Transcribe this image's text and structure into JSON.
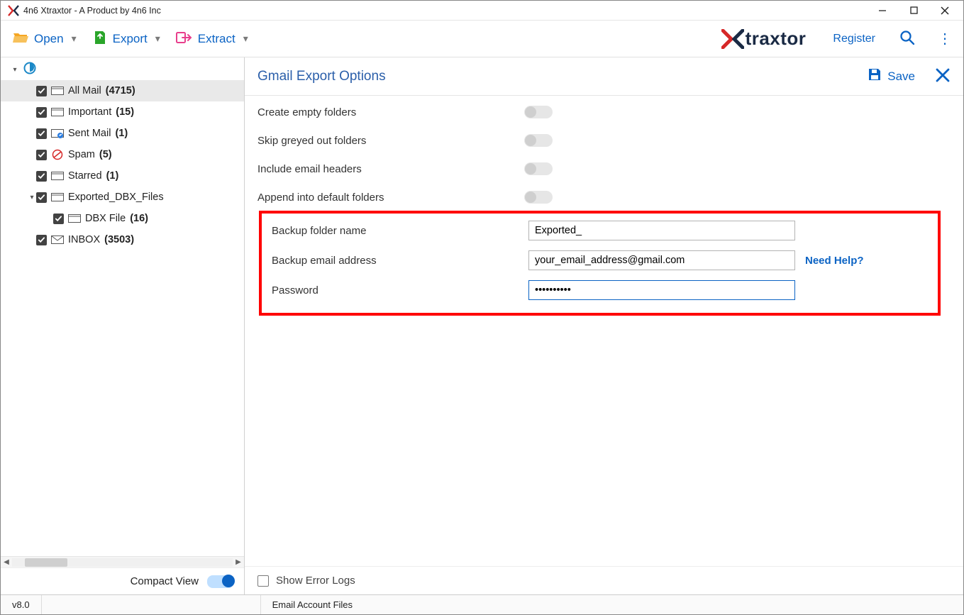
{
  "titlebar": {
    "title": "4n6 Xtraxtor - A Product by 4n6 Inc"
  },
  "toolbar": {
    "open_label": "Open",
    "export_label": "Export",
    "extract_label": "Extract",
    "brand_name": "traxtor",
    "register_label": "Register"
  },
  "sidebar": {
    "tree": {
      "root_icon": "edge-icon",
      "items": [
        {
          "name": "All Mail",
          "count": "(4715)",
          "checked": true,
          "icon": "folder",
          "level": 2,
          "selected": true,
          "bold_count": true
        },
        {
          "name": "Important",
          "count": "(15)",
          "checked": true,
          "icon": "folder",
          "level": 2
        },
        {
          "name": "Sent Mail",
          "count": "(1)",
          "checked": true,
          "icon": "sent",
          "level": 2
        },
        {
          "name": "Spam",
          "count": "(5)",
          "checked": true,
          "icon": "spam",
          "level": 2
        },
        {
          "name": "Starred",
          "count": "(1)",
          "checked": true,
          "icon": "folder",
          "level": 2
        },
        {
          "name": "Exported_DBX_Files",
          "count": "",
          "checked": true,
          "icon": "folder",
          "level": 2,
          "expander": "▾"
        },
        {
          "name": "DBX File",
          "count": "(16)",
          "checked": true,
          "icon": "folder",
          "level": 3
        },
        {
          "name": "INBOX",
          "count": "(3503)",
          "checked": true,
          "icon": "inbox",
          "level": 2,
          "bold_count": true
        }
      ]
    },
    "compact_label": "Compact View"
  },
  "content": {
    "header_title": "Gmail Export Options",
    "save_label": "Save",
    "options": {
      "create_empty_label": "Create empty folders",
      "skip_greyed_label": "Skip greyed out folders",
      "include_headers_label": "Include email headers",
      "append_default_label": "Append into default folders",
      "backup_folder_label": "Backup folder name",
      "backup_folder_value": "Exported_",
      "backup_email_label": "Backup email address",
      "backup_email_value": "your_email_address@gmail.com",
      "need_help_label": "Need Help?",
      "password_label": "Password",
      "password_value": "••••••••••"
    },
    "show_error_logs_label": "Show Error Logs"
  },
  "statusbar": {
    "version": "v8.0",
    "context": "Email Account Files"
  }
}
